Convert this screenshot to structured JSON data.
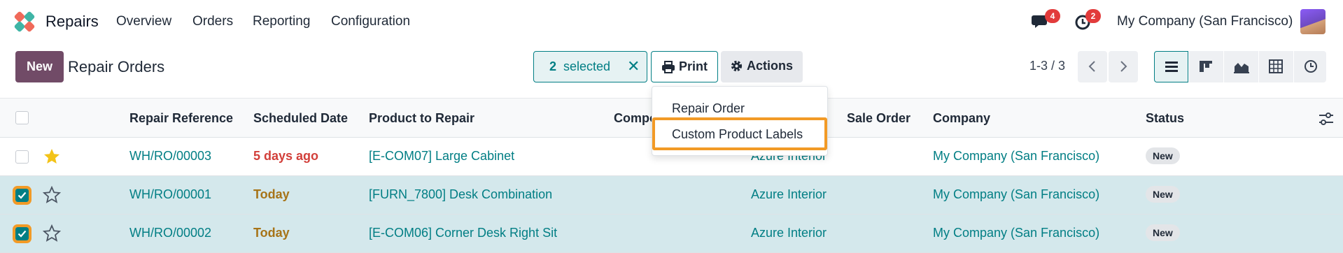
{
  "topnav": {
    "app_name": "Repairs",
    "menu": [
      "Overview",
      "Orders",
      "Reporting",
      "Configuration"
    ],
    "messages_badge": "4",
    "activities_badge": "2",
    "company": "My Company (San Francisco)"
  },
  "control_panel": {
    "new_label": "New",
    "title": "Repair Orders",
    "selected_count": "2",
    "selected_label": "selected",
    "print_label": "Print",
    "actions_label": "Actions",
    "pager": "1-3 / 3"
  },
  "dropdown": {
    "items": [
      "Repair Order",
      "Custom Product Labels"
    ]
  },
  "table": {
    "columns": {
      "reference": "Repair Reference",
      "scheduled": "Scheduled Date",
      "product": "Product to Repair",
      "component": "Compo",
      "sale_order": "Sale Order",
      "company": "Company",
      "status": "Status"
    },
    "rows": [
      {
        "reference": "WH/RO/00003",
        "date": "5 days ago",
        "product": "[E-COM07] Large Cabinet",
        "customer": "Azure Interior",
        "company": "My Company (San Francisco)",
        "status": "New",
        "starred": true,
        "selected": false
      },
      {
        "reference": "WH/RO/00001",
        "date": "Today",
        "product": "[FURN_7800] Desk Combination",
        "customer": "Azure Interior",
        "company": "My Company (San Francisco)",
        "status": "New",
        "starred": false,
        "selected": true
      },
      {
        "reference": "WH/RO/00002",
        "date": "Today",
        "product": "[E-COM06] Corner Desk Right Sit",
        "customer": "Azure Interior",
        "company": "My Company (San Francisco)",
        "status": "New",
        "starred": false,
        "selected": true
      }
    ]
  },
  "colors": {
    "brand": "#714b67",
    "accent": "#017e84",
    "highlight": "#f29a26",
    "late": "#d23f3a",
    "today": "#a77418"
  }
}
